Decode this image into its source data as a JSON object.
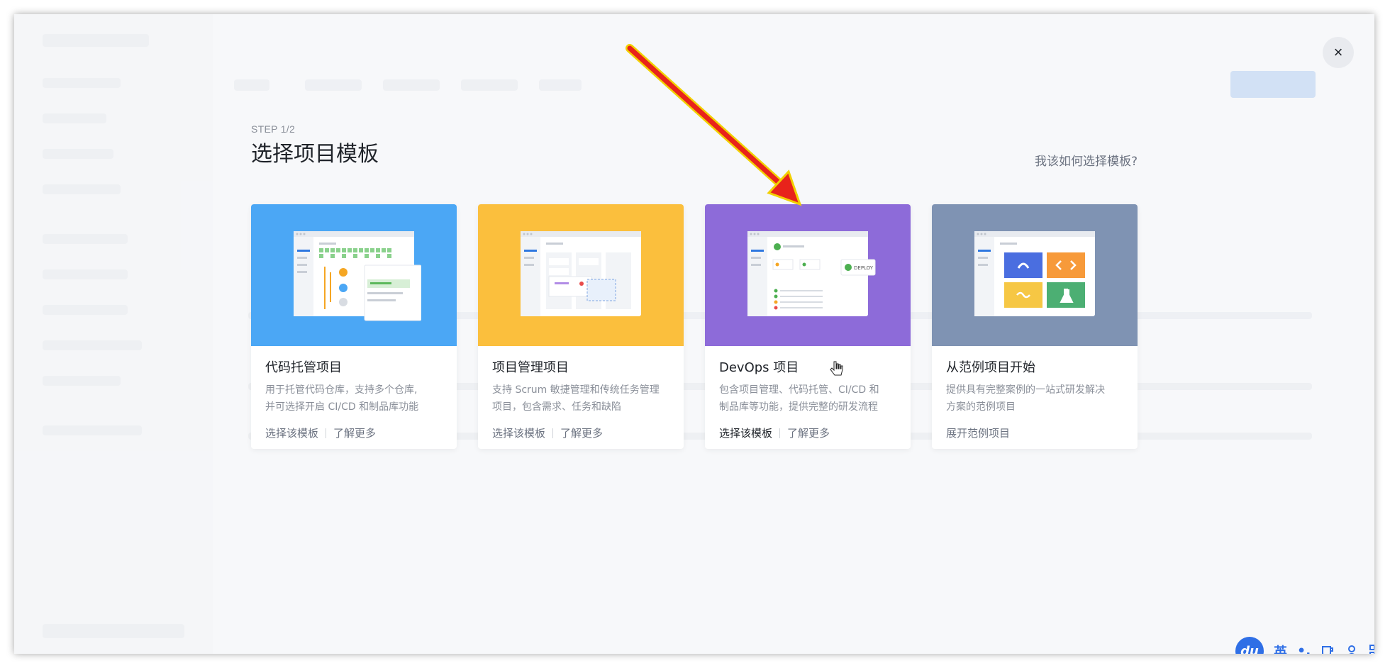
{
  "modal": {
    "step": "STEP 1/2",
    "title": "选择项目模板",
    "help_link": "我该如何选择模板?",
    "close_label": "×"
  },
  "cards": [
    {
      "name": "代码托管项目",
      "desc_line1": "用于托管代码仓库，支持多个仓库,",
      "desc_line2": "并可选择开启 CI/CD 和制品库功能",
      "action1": "选择该模板",
      "action2": "了解更多",
      "color": "#4ba7f5"
    },
    {
      "name": "项目管理项目",
      "desc_line1": "支持 Scrum 敏捷管理和传统任务管理",
      "desc_line2": "项目，包含需求、任务和缺陷",
      "action1": "选择该模板",
      "action2": "了解更多",
      "color": "#fbbf3d"
    },
    {
      "name": "DevOps 项目",
      "desc_line1": "包含项目管理、代码托管、CI/CD 和",
      "desc_line2": "制品库等功能，提供完整的研发流程",
      "action1": "选择该模板",
      "action2": "了解更多",
      "badge": "DEPLOY",
      "color": "#8d6bd9"
    },
    {
      "name": "从范例项目开始",
      "desc_line1": "提供具有完整案例的一站式研发解决",
      "desc_line2": "方案的范例项目",
      "action1": "展开范例项目",
      "color": "#7f93b3"
    }
  ],
  "ime": {
    "logo": "du",
    "lang": "英",
    "punct": "•,"
  },
  "colors": {
    "accent": "#2f78e0",
    "arrow": "#e8231b",
    "arrow_outline": "#f2d000"
  }
}
